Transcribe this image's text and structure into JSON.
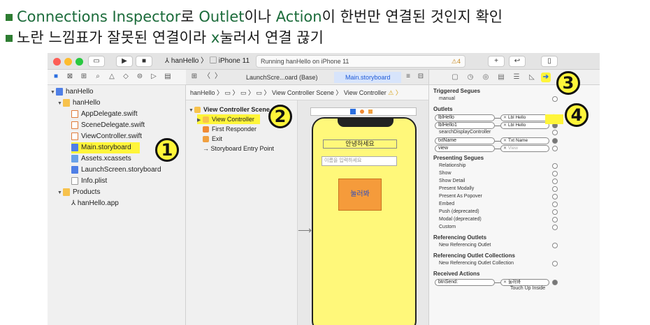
{
  "bullets": [
    {
      "parts": [
        {
          "t": "Connections Inspector",
          "g": true
        },
        {
          "t": "로 ",
          "g": false
        },
        {
          "t": "Outlet",
          "g": true
        },
        {
          "t": "이나 ",
          "g": false
        },
        {
          "t": "Action",
          "g": true
        },
        {
          "t": "이 한번만 연결된 것인지 확인",
          "g": false
        }
      ]
    },
    {
      "parts": [
        {
          "t": "노란 느낌표가 잘못된 연결이라 ",
          "g": false
        },
        {
          "t": "x",
          "g": true
        },
        {
          "t": "눌러서 연결 끊기",
          "g": false
        }
      ]
    }
  ],
  "toolbar": {
    "scheme": "hanHello",
    "device": "iPhone 11",
    "status": "Running hanHello on iPhone 11",
    "warning_count": "4"
  },
  "editor": {
    "tab_launch": "LaunchScre...oard (Base)",
    "tab_main": "Main.storyboard",
    "jumpbar": "hanHello 〉 ▭ 〉 ▭ 〉 ▭ 〉 View Controller Scene 〉 View Controller",
    "warn": "⚠ 〉"
  },
  "navigator": {
    "project": "hanHello",
    "group": "hanHello",
    "files": [
      "AppDelegate.swift",
      "SceneDelegate.swift",
      "ViewController.swift",
      "Main.storyboard",
      "Assets.xcassets",
      "LaunchScreen.storyboard",
      "Info.plist"
    ],
    "products_group": "Products",
    "product": "hanHello.app"
  },
  "outline": {
    "scene": "View Controller Scene",
    "items": [
      "View Controller",
      "First Responder",
      "Exit",
      "Storyboard Entry Point"
    ]
  },
  "canvas": {
    "label_text": "안녕하세요",
    "field_placeholder": "이름을 입력하세요",
    "button_text": "눌러봐"
  },
  "inspector": {
    "triggered": "Triggered Segues",
    "manual": "manual",
    "outlets": "Outlets",
    "outlet_rows": [
      {
        "name": "lblHello",
        "target": "Lbl Hello"
      },
      {
        "name": "lblHello1",
        "target": "Lbl Hello"
      },
      {
        "name": "searchDisplayController",
        "target": ""
      },
      {
        "name": "txtName",
        "target": "Txt Name"
      },
      {
        "name": "view",
        "target": "View"
      }
    ],
    "presenting": "Presenting Segues",
    "presenting_rows": [
      "Relationship",
      "Show",
      "Show Detail",
      "Present Modally",
      "Present As Popover",
      "Embed",
      "Push (deprecated)",
      "Modal (deprecated)",
      "Custom"
    ],
    "ref_outlets": "Referencing Outlets",
    "new_ref_outlet": "New Referencing Outlet",
    "ref_collections": "Referencing Outlet Collections",
    "new_ref_collection": "New Referencing Outlet Collection",
    "received": "Received Actions",
    "action_name": "btnSend:",
    "action_target": "눌러봐",
    "action_event": "Touch Up Inside"
  },
  "callouts": [
    "1",
    "2",
    "3",
    "4"
  ]
}
